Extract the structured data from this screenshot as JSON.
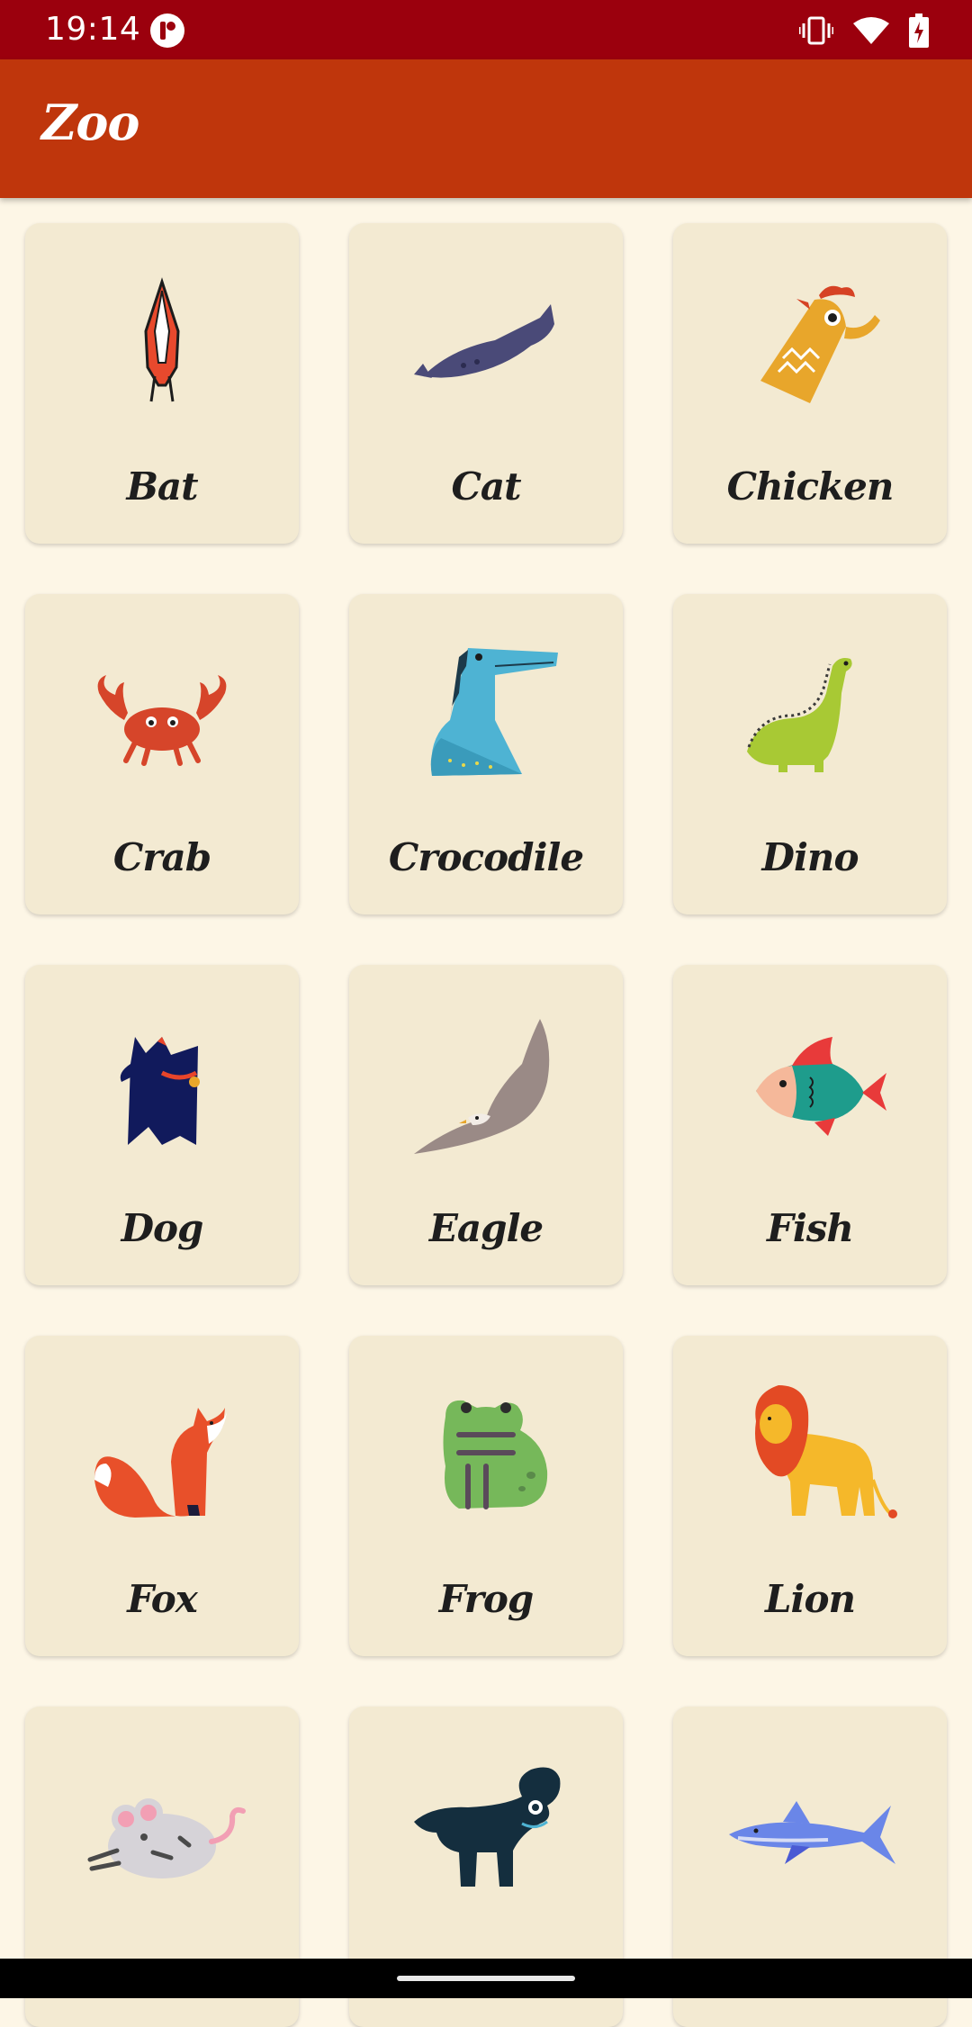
{
  "status_bar": {
    "time": "19:14",
    "icons": [
      "app-notification-icon",
      "vibrate-icon",
      "wifi-icon",
      "battery-charging-icon"
    ]
  },
  "app_bar": {
    "title": "Zoo"
  },
  "animals": [
    {
      "name": "Bat",
      "icon": "bat-icon"
    },
    {
      "name": "Cat",
      "icon": "cat-icon"
    },
    {
      "name": "Chicken",
      "icon": "chicken-icon"
    },
    {
      "name": "Crab",
      "icon": "crab-icon"
    },
    {
      "name": "Crocodile",
      "icon": "crocodile-icon"
    },
    {
      "name": "Dino",
      "icon": "dino-icon"
    },
    {
      "name": "Dog",
      "icon": "dog-icon"
    },
    {
      "name": "Eagle",
      "icon": "eagle-icon"
    },
    {
      "name": "Fish",
      "icon": "fish-icon"
    },
    {
      "name": "Fox",
      "icon": "fox-icon"
    },
    {
      "name": "Frog",
      "icon": "frog-icon"
    },
    {
      "name": "Lion",
      "icon": "lion-icon"
    },
    {
      "name": "",
      "icon": "mouse-icon"
    },
    {
      "name": "",
      "icon": "creature-icon"
    },
    {
      "name": "",
      "icon": "shark-icon"
    }
  ],
  "colors": {
    "status_bar": "#9b000d",
    "app_bar": "#bf360c",
    "background": "#fdf6e6",
    "card": "#f3ead2"
  }
}
